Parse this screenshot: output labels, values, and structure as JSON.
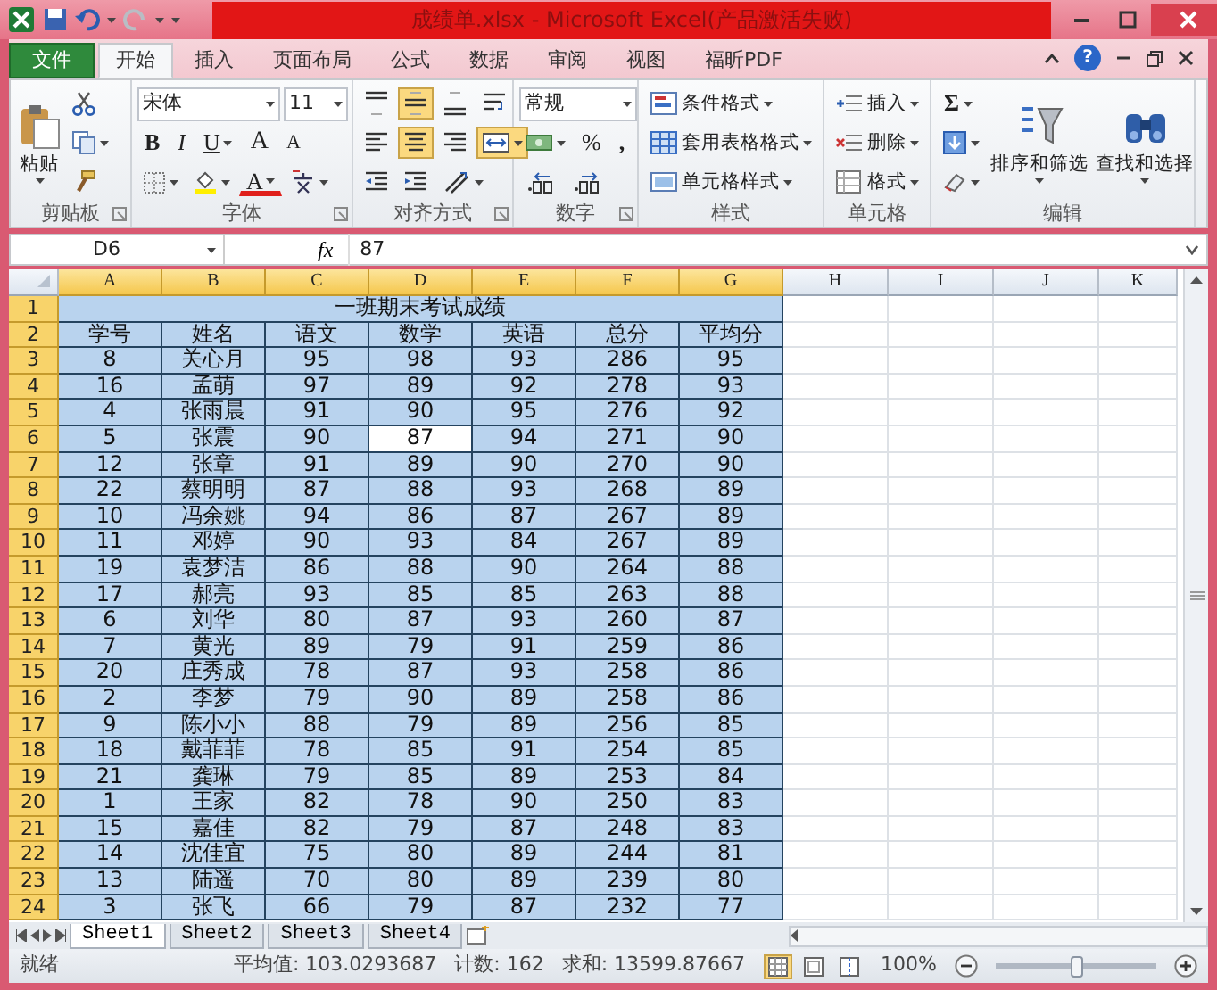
{
  "window": {
    "title": "成绩单.xlsx - Microsoft Excel(产品激活失败)"
  },
  "tabs": [
    {
      "label": "文件",
      "kind": "file",
      "selected": false
    },
    {
      "label": "开始",
      "kind": "tab",
      "selected": true
    },
    {
      "label": "插入",
      "kind": "tab",
      "selected": false
    },
    {
      "label": "页面布局",
      "kind": "tab",
      "selected": false
    },
    {
      "label": "公式",
      "kind": "tab",
      "selected": false
    },
    {
      "label": "数据",
      "kind": "tab",
      "selected": false
    },
    {
      "label": "审阅",
      "kind": "tab",
      "selected": false
    },
    {
      "label": "视图",
      "kind": "tab",
      "selected": false
    },
    {
      "label": "福昕PDF",
      "kind": "tab",
      "selected": false
    }
  ],
  "help": "?",
  "ribbon": {
    "groups": [
      {
        "label": "剪贴板",
        "launcher": true,
        "stacks": [
          {
            "lines": [
              {
                "items": [
                  {
                    "kind": "paste",
                    "label": "粘贴",
                    "menu": true
                  }
                ]
              }
            ]
          },
          {
            "lines": [
              {
                "items": [
                  {
                    "kind": "cut"
                  }
                ]
              },
              {
                "items": [
                  {
                    "kind": "copy",
                    "menu": true
                  }
                ]
              },
              {
                "items": [
                  {
                    "kind": "painter"
                  }
                ]
              }
            ]
          }
        ]
      },
      {
        "label": "字体",
        "launcher": true,
        "stacks": [
          {
            "lines": [
              {
                "items": [
                  {
                    "kind": "font-field",
                    "value": "宋体"
                  },
                  {
                    "kind": "size-field",
                    "value": "11"
                  }
                ]
              },
              {
                "items": [
                  {
                    "kind": "bold",
                    "label": "B"
                  },
                  {
                    "kind": "italic",
                    "label": "I"
                  },
                  {
                    "kind": "underline",
                    "label": "U",
                    "menu": true
                  },
                  {
                    "kind": "grow",
                    "label": "A"
                  },
                  {
                    "kind": "shrink",
                    "label": "A"
                  }
                ]
              },
              {
                "items": [
                  {
                    "kind": "borders",
                    "menu": true
                  },
                  {
                    "kind": "fill",
                    "menu": true
                  },
                  {
                    "kind": "font-color",
                    "label": "A",
                    "menu": true
                  },
                  {
                    "kind": "phonetic",
                    "menu": true
                  }
                ]
              }
            ]
          }
        ]
      },
      {
        "label": "对齐方式",
        "launcher": true,
        "stacks": [
          {
            "lines": [
              {
                "items": [
                  {
                    "kind": "align-top",
                    "selected": false
                  },
                  {
                    "kind": "align-middle",
                    "selected": true
                  },
                  {
                    "kind": "align-bottom",
                    "selected": false
                  },
                  {
                    "kind": "wrap",
                    "selected": false
                  }
                ]
              },
              {
                "items": [
                  {
                    "kind": "align-left",
                    "selected": false
                  },
                  {
                    "kind": "align-center",
                    "selected": true
                  },
                  {
                    "kind": "align-right",
                    "selected": false
                  },
                  {
                    "kind": "merge",
                    "selected": true,
                    "menu": true
                  }
                ]
              },
              {
                "items": [
                  {
                    "kind": "indent-dec"
                  },
                  {
                    "kind": "indent-inc"
                  },
                  {
                    "kind": "orientation",
                    "menu": true
                  }
                ]
              }
            ]
          }
        ]
      },
      {
        "label": "数字",
        "launcher": true,
        "stacks": [
          {
            "lines": [
              {
                "items": [
                  {
                    "kind": "format-field",
                    "value": "常规"
                  }
                ]
              },
              {
                "items": [
                  {
                    "kind": "currency",
                    "menu": true
                  },
                  {
                    "kind": "percent",
                    "label": "%"
                  },
                  {
                    "kind": "comma",
                    "label": ","
                  }
                ]
              },
              {
                "items": [
                  {
                    "kind": "dec-inc"
                  },
                  {
                    "kind": "dec-dec"
                  }
                ]
              }
            ]
          }
        ]
      },
      {
        "label": "样式",
        "launcher": false,
        "stacks": [
          {
            "lines": [
              {
                "items": [
                  {
                    "kind": "conditional",
                    "label": "条件格式",
                    "menu": true
                  }
                ]
              },
              {
                "items": [
                  {
                    "kind": "table-format",
                    "label": "套用表格格式",
                    "menu": true
                  }
                ]
              },
              {
                "items": [
                  {
                    "kind": "cell-style",
                    "label": "单元格样式",
                    "menu": true
                  }
                ]
              }
            ]
          }
        ]
      },
      {
        "label": "单元格",
        "launcher": false,
        "stacks": [
          {
            "lines": [
              {
                "items": [
                  {
                    "kind": "insert",
                    "label": "插入",
                    "menu": true
                  }
                ]
              },
              {
                "items": [
                  {
                    "kind": "delete",
                    "label": "删除",
                    "menu": true
                  }
                ]
              },
              {
                "items": [
                  {
                    "kind": "format",
                    "label": "格式",
                    "menu": true
                  }
                ]
              }
            ]
          }
        ]
      },
      {
        "label": "编辑",
        "launcher": false,
        "stacks": [
          {
            "lines": [
              {
                "items": [
                  {
                    "kind": "sum",
                    "label": "Σ",
                    "menu": true
                  }
                ]
              },
              {
                "items": [
                  {
                    "kind": "fill-down",
                    "menu": true
                  }
                ]
              },
              {
                "items": [
                  {
                    "kind": "clear",
                    "menu": true
                  }
                ]
              }
            ]
          },
          {
            "lines": [
              {
                "items": [
                  {
                    "kind": "sort-filter",
                    "label": "排序和筛选",
                    "menu": true
                  }
                ]
              }
            ]
          },
          {
            "lines": [
              {
                "items": [
                  {
                    "kind": "find-select",
                    "label": "查找和选择",
                    "menu": true
                  }
                ]
              }
            ]
          }
        ]
      }
    ]
  },
  "formula_bar": {
    "name_box": "D6",
    "function_label": "fx",
    "value": "87"
  },
  "sheet": {
    "columns": [
      {
        "label": "A",
        "highlighted": true
      },
      {
        "label": "B",
        "highlighted": true
      },
      {
        "label": "C",
        "highlighted": true
      },
      {
        "label": "D",
        "highlighted": true
      },
      {
        "label": "E",
        "highlighted": true
      },
      {
        "label": "F",
        "highlighted": true
      },
      {
        "label": "G",
        "highlighted": true
      },
      {
        "label": "H",
        "highlighted": false
      },
      {
        "label": "I",
        "highlighted": false
      },
      {
        "label": "J",
        "highlighted": false
      },
      {
        "label": "K",
        "highlighted": false
      }
    ],
    "rows": [
      {
        "header": "1",
        "highlighted": true,
        "kind": "title",
        "text": "一班期末考试成绩"
      },
      {
        "header": "2",
        "highlighted": true,
        "kind": "data",
        "cells": [
          {
            "text": "学号",
            "selected": false
          },
          {
            "text": "姓名",
            "selected": false
          },
          {
            "text": "语文",
            "selected": false
          },
          {
            "text": "数学",
            "selected": false
          },
          {
            "text": "英语",
            "selected": false
          },
          {
            "text": "总分",
            "selected": false
          },
          {
            "text": "平均分",
            "selected": false
          }
        ]
      },
      {
        "header": "3",
        "highlighted": true,
        "kind": "data",
        "cells": [
          {
            "text": "8",
            "selected": false
          },
          {
            "text": "关心月",
            "selected": false
          },
          {
            "text": "95",
            "selected": false
          },
          {
            "text": "98",
            "selected": false
          },
          {
            "text": "93",
            "selected": false
          },
          {
            "text": "286",
            "selected": false
          },
          {
            "text": "95",
            "selected": false
          }
        ]
      },
      {
        "header": "4",
        "highlighted": true,
        "kind": "data",
        "cells": [
          {
            "text": "16",
            "selected": false
          },
          {
            "text": "孟萌",
            "selected": false
          },
          {
            "text": "97",
            "selected": false
          },
          {
            "text": "89",
            "selected": false
          },
          {
            "text": "92",
            "selected": false
          },
          {
            "text": "278",
            "selected": false
          },
          {
            "text": "93",
            "selected": false
          }
        ]
      },
      {
        "header": "5",
        "highlighted": true,
        "kind": "data",
        "cells": [
          {
            "text": "4",
            "selected": false
          },
          {
            "text": "张雨晨",
            "selected": false
          },
          {
            "text": "91",
            "selected": false
          },
          {
            "text": "90",
            "selected": false
          },
          {
            "text": "95",
            "selected": false
          },
          {
            "text": "276",
            "selected": false
          },
          {
            "text": "92",
            "selected": false
          }
        ]
      },
      {
        "header": "6",
        "highlighted": true,
        "kind": "data",
        "cells": [
          {
            "text": "5",
            "selected": false
          },
          {
            "text": "张震",
            "selected": false
          },
          {
            "text": "90",
            "selected": false
          },
          {
            "text": "87",
            "selected": true
          },
          {
            "text": "94",
            "selected": false
          },
          {
            "text": "271",
            "selected": false
          },
          {
            "text": "90",
            "selected": false
          }
        ]
      },
      {
        "header": "7",
        "highlighted": true,
        "kind": "data",
        "cells": [
          {
            "text": "12",
            "selected": false
          },
          {
            "text": "张章",
            "selected": false
          },
          {
            "text": "91",
            "selected": false
          },
          {
            "text": "89",
            "selected": false
          },
          {
            "text": "90",
            "selected": false
          },
          {
            "text": "270",
            "selected": false
          },
          {
            "text": "90",
            "selected": false
          }
        ]
      },
      {
        "header": "8",
        "highlighted": true,
        "kind": "data",
        "cells": [
          {
            "text": "22",
            "selected": false
          },
          {
            "text": "蔡明明",
            "selected": false
          },
          {
            "text": "87",
            "selected": false
          },
          {
            "text": "88",
            "selected": false
          },
          {
            "text": "93",
            "selected": false
          },
          {
            "text": "268",
            "selected": false
          },
          {
            "text": "89",
            "selected": false
          }
        ]
      },
      {
        "header": "9",
        "highlighted": true,
        "kind": "data",
        "cells": [
          {
            "text": "10",
            "selected": false
          },
          {
            "text": "冯余姚",
            "selected": false
          },
          {
            "text": "94",
            "selected": false
          },
          {
            "text": "86",
            "selected": false
          },
          {
            "text": "87",
            "selected": false
          },
          {
            "text": "267",
            "selected": false
          },
          {
            "text": "89",
            "selected": false
          }
        ]
      },
      {
        "header": "10",
        "highlighted": true,
        "kind": "data",
        "cells": [
          {
            "text": "11",
            "selected": false
          },
          {
            "text": "邓婷",
            "selected": false
          },
          {
            "text": "90",
            "selected": false
          },
          {
            "text": "93",
            "selected": false
          },
          {
            "text": "84",
            "selected": false
          },
          {
            "text": "267",
            "selected": false
          },
          {
            "text": "89",
            "selected": false
          }
        ]
      },
      {
        "header": "11",
        "highlighted": true,
        "kind": "data",
        "cells": [
          {
            "text": "19",
            "selected": false
          },
          {
            "text": "袁梦洁",
            "selected": false
          },
          {
            "text": "86",
            "selected": false
          },
          {
            "text": "88",
            "selected": false
          },
          {
            "text": "90",
            "selected": false
          },
          {
            "text": "264",
            "selected": false
          },
          {
            "text": "88",
            "selected": false
          }
        ]
      },
      {
        "header": "12",
        "highlighted": true,
        "kind": "data",
        "cells": [
          {
            "text": "17",
            "selected": false
          },
          {
            "text": "郝亮",
            "selected": false
          },
          {
            "text": "93",
            "selected": false
          },
          {
            "text": "85",
            "selected": false
          },
          {
            "text": "85",
            "selected": false
          },
          {
            "text": "263",
            "selected": false
          },
          {
            "text": "88",
            "selected": false
          }
        ]
      },
      {
        "header": "13",
        "highlighted": true,
        "kind": "data",
        "cells": [
          {
            "text": "6",
            "selected": false
          },
          {
            "text": "刘华",
            "selected": false
          },
          {
            "text": "80",
            "selected": false
          },
          {
            "text": "87",
            "selected": false
          },
          {
            "text": "93",
            "selected": false
          },
          {
            "text": "260",
            "selected": false
          },
          {
            "text": "87",
            "selected": false
          }
        ]
      },
      {
        "header": "14",
        "highlighted": true,
        "kind": "data",
        "cells": [
          {
            "text": "7",
            "selected": false
          },
          {
            "text": "黄光",
            "selected": false
          },
          {
            "text": "89",
            "selected": false
          },
          {
            "text": "79",
            "selected": false
          },
          {
            "text": "91",
            "selected": false
          },
          {
            "text": "259",
            "selected": false
          },
          {
            "text": "86",
            "selected": false
          }
        ]
      },
      {
        "header": "15",
        "highlighted": true,
        "kind": "data",
        "cells": [
          {
            "text": "20",
            "selected": false
          },
          {
            "text": "庄秀成",
            "selected": false
          },
          {
            "text": "78",
            "selected": false
          },
          {
            "text": "87",
            "selected": false
          },
          {
            "text": "93",
            "selected": false
          },
          {
            "text": "258",
            "selected": false
          },
          {
            "text": "86",
            "selected": false
          }
        ]
      },
      {
        "header": "16",
        "highlighted": true,
        "kind": "data",
        "cells": [
          {
            "text": "2",
            "selected": false
          },
          {
            "text": "李梦",
            "selected": false
          },
          {
            "text": "79",
            "selected": false
          },
          {
            "text": "90",
            "selected": false
          },
          {
            "text": "89",
            "selected": false
          },
          {
            "text": "258",
            "selected": false
          },
          {
            "text": "86",
            "selected": false
          }
        ]
      },
      {
        "header": "17",
        "highlighted": true,
        "kind": "data",
        "cells": [
          {
            "text": "9",
            "selected": false
          },
          {
            "text": "陈小小",
            "selected": false
          },
          {
            "text": "88",
            "selected": false
          },
          {
            "text": "79",
            "selected": false
          },
          {
            "text": "89",
            "selected": false
          },
          {
            "text": "256",
            "selected": false
          },
          {
            "text": "85",
            "selected": false
          }
        ]
      },
      {
        "header": "18",
        "highlighted": true,
        "kind": "data",
        "cells": [
          {
            "text": "18",
            "selected": false
          },
          {
            "text": "戴菲菲",
            "selected": false
          },
          {
            "text": "78",
            "selected": false
          },
          {
            "text": "85",
            "selected": false
          },
          {
            "text": "91",
            "selected": false
          },
          {
            "text": "254",
            "selected": false
          },
          {
            "text": "85",
            "selected": false
          }
        ]
      },
      {
        "header": "19",
        "highlighted": true,
        "kind": "data",
        "cells": [
          {
            "text": "21",
            "selected": false
          },
          {
            "text": "龚琳",
            "selected": false
          },
          {
            "text": "79",
            "selected": false
          },
          {
            "text": "85",
            "selected": false
          },
          {
            "text": "89",
            "selected": false
          },
          {
            "text": "253",
            "selected": false
          },
          {
            "text": "84",
            "selected": false
          }
        ]
      },
      {
        "header": "20",
        "highlighted": true,
        "kind": "data",
        "cells": [
          {
            "text": "1",
            "selected": false
          },
          {
            "text": "王家",
            "selected": false
          },
          {
            "text": "82",
            "selected": false
          },
          {
            "text": "78",
            "selected": false
          },
          {
            "text": "90",
            "selected": false
          },
          {
            "text": "250",
            "selected": false
          },
          {
            "text": "83",
            "selected": false
          }
        ]
      },
      {
        "header": "21",
        "highlighted": true,
        "kind": "data",
        "cells": [
          {
            "text": "15",
            "selected": false
          },
          {
            "text": "嘉佳",
            "selected": false
          },
          {
            "text": "82",
            "selected": false
          },
          {
            "text": "79",
            "selected": false
          },
          {
            "text": "87",
            "selected": false
          },
          {
            "text": "248",
            "selected": false
          },
          {
            "text": "83",
            "selected": false
          }
        ]
      },
      {
        "header": "22",
        "highlighted": true,
        "kind": "data",
        "cells": [
          {
            "text": "14",
            "selected": false
          },
          {
            "text": "沈佳宜",
            "selected": false
          },
          {
            "text": "75",
            "selected": false
          },
          {
            "text": "80",
            "selected": false
          },
          {
            "text": "89",
            "selected": false
          },
          {
            "text": "244",
            "selected": false
          },
          {
            "text": "81",
            "selected": false
          }
        ]
      },
      {
        "header": "23",
        "highlighted": true,
        "kind": "data",
        "cells": [
          {
            "text": "13",
            "selected": false
          },
          {
            "text": "陆遥",
            "selected": false
          },
          {
            "text": "70",
            "selected": false
          },
          {
            "text": "80",
            "selected": false
          },
          {
            "text": "89",
            "selected": false
          },
          {
            "text": "239",
            "selected": false
          },
          {
            "text": "80",
            "selected": false
          }
        ]
      },
      {
        "header": "24",
        "highlighted": true,
        "kind": "data",
        "cells": [
          {
            "text": "3",
            "selected": false
          },
          {
            "text": "张飞",
            "selected": false
          },
          {
            "text": "66",
            "selected": false
          },
          {
            "text": "79",
            "selected": false
          },
          {
            "text": "87",
            "selected": false
          },
          {
            "text": "232",
            "selected": false
          },
          {
            "text": "77",
            "selected": false
          }
        ]
      }
    ]
  },
  "sheet_tabs": [
    {
      "label": "Sheet1",
      "selected": true
    },
    {
      "label": "Sheet2",
      "selected": false
    },
    {
      "label": "Sheet3",
      "selected": false
    },
    {
      "label": "Sheet4",
      "selected": false
    }
  ],
  "status_bar": {
    "ready": "就绪",
    "average": "平均值: 103.0293687",
    "count": "计数: 162",
    "sum": "求和: 13599.87667",
    "views": [
      {
        "kind": "normal",
        "selected": true
      },
      {
        "kind": "page-layout",
        "selected": false
      },
      {
        "kind": "page-break",
        "selected": false
      }
    ],
    "zoom": "100%",
    "zoom_slider": {
      "level": 0.5
    }
  }
}
